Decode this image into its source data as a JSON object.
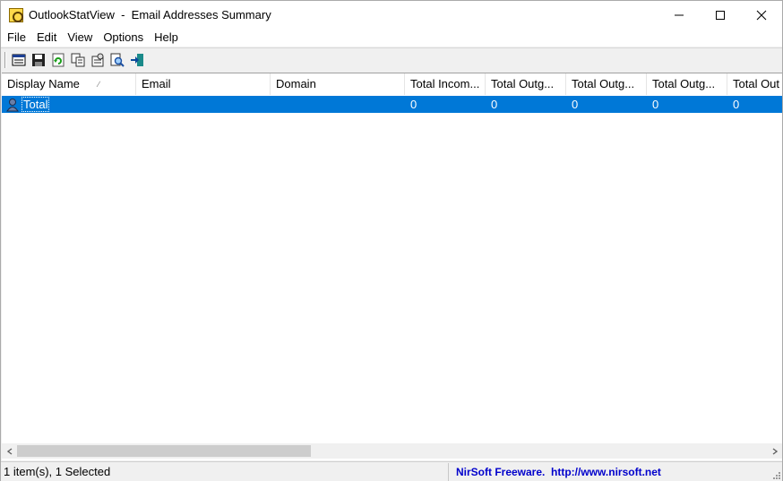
{
  "window": {
    "title": "OutlookStatView  -  Email Addresses Summary"
  },
  "menu": [
    "File",
    "Edit",
    "View",
    "Options",
    "Help"
  ],
  "toolbar": {
    "buttons": [
      {
        "icon": "html-report-icon"
      },
      {
        "icon": "save-icon"
      },
      {
        "icon": "refresh-icon"
      },
      {
        "icon": "copy-icon"
      },
      {
        "icon": "properties-icon"
      },
      {
        "icon": "find-icon"
      },
      {
        "icon": "exit-icon"
      }
    ]
  },
  "table": {
    "columns": [
      {
        "label": "Display Name",
        "sorted": true
      },
      {
        "label": "Email"
      },
      {
        "label": "Domain"
      },
      {
        "label": "Total Incom..."
      },
      {
        "label": "Total Outg..."
      },
      {
        "label": "Total Outg..."
      },
      {
        "label": "Total Outg..."
      },
      {
        "label": "Total Out"
      }
    ],
    "rows": [
      {
        "cells": [
          "Total",
          "",
          "",
          "0",
          "0",
          "0",
          "0",
          "0"
        ],
        "selected": true
      }
    ]
  },
  "status": {
    "items_text": "1 item(s), 1 Selected",
    "credit_text": "NirSoft Freeware.  http://www.nirsoft.net"
  },
  "colors": {
    "selection": "#0078d7",
    "credit_link": "#0000cc"
  }
}
